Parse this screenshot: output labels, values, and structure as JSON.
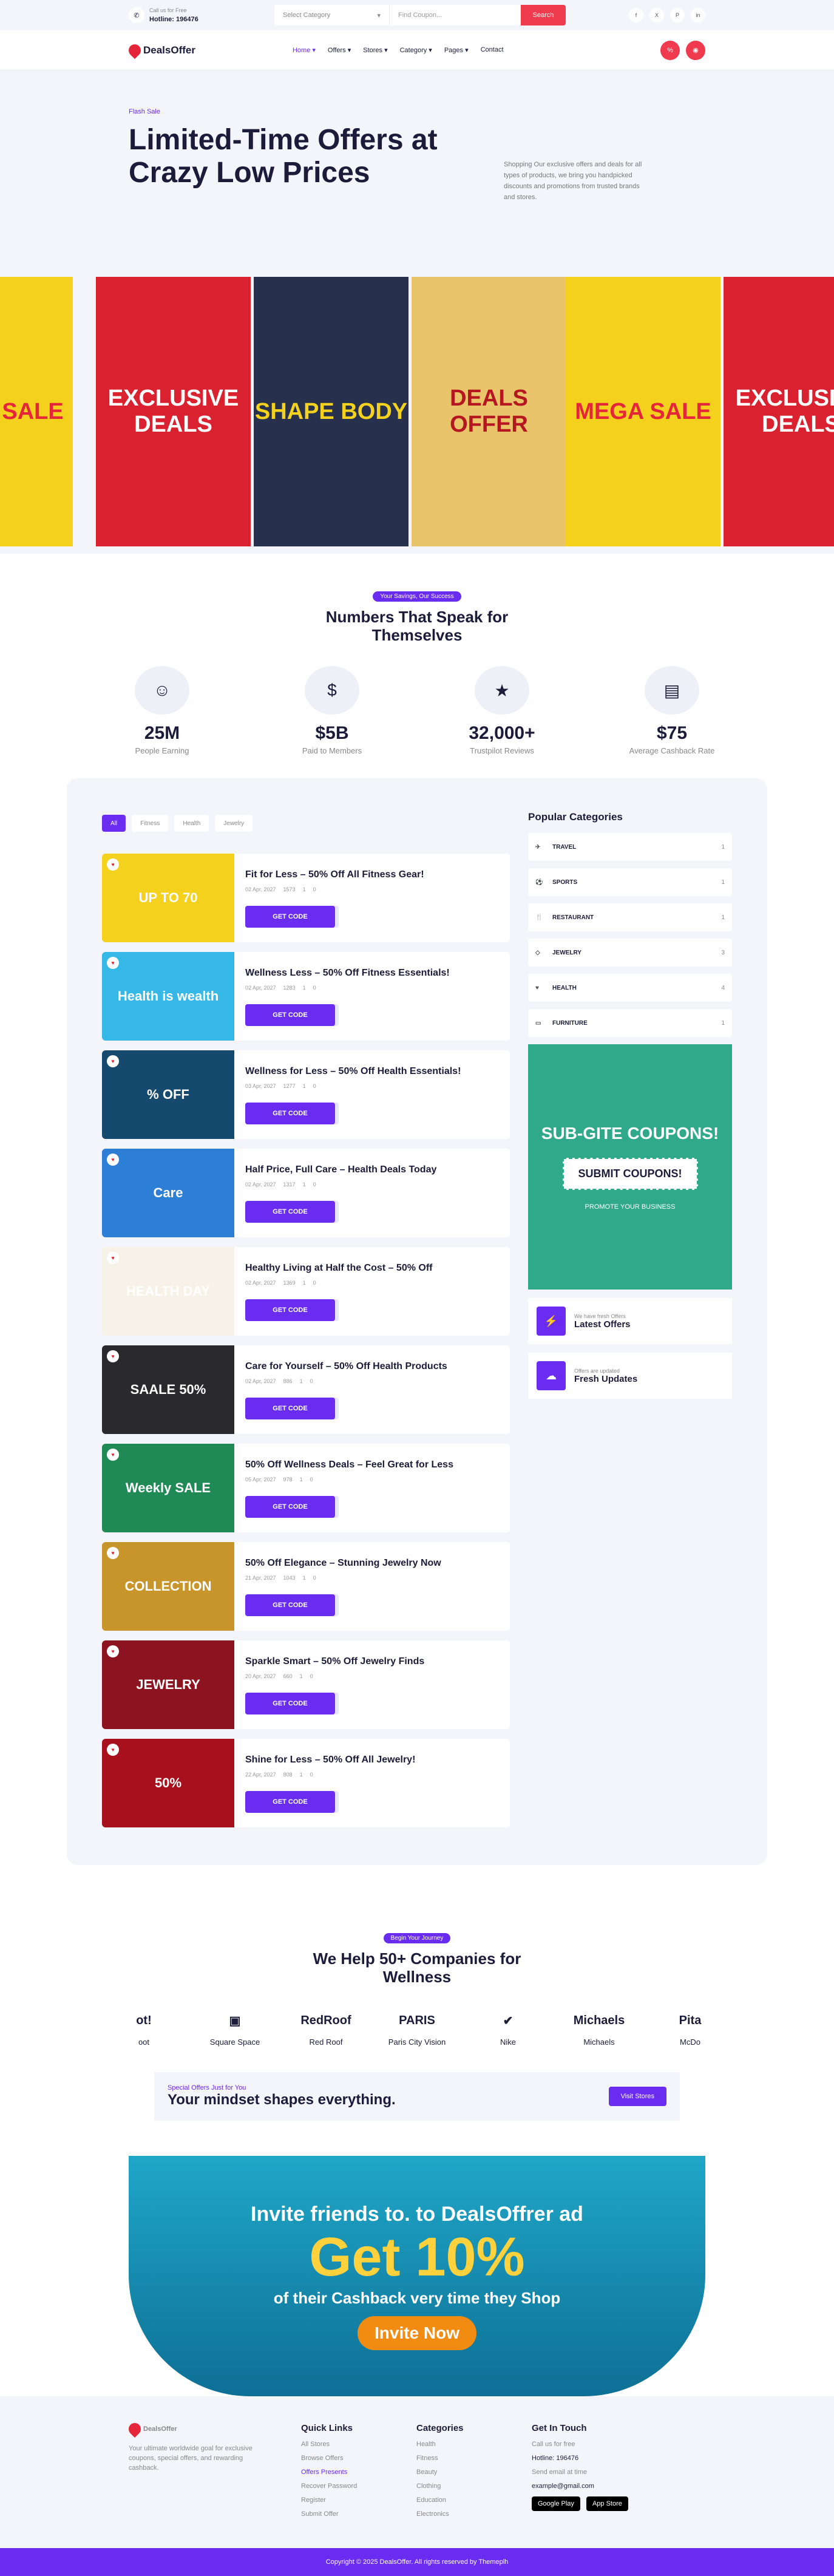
{
  "topbar": {
    "call_label": "Call us for Free",
    "hotline": "Hotline: 196476",
    "category_placeholder": "Select Category",
    "coupon_placeholder": "Find Coupon...",
    "search_label": "Search",
    "socials": [
      "f",
      "X",
      "P",
      "in"
    ]
  },
  "nav": {
    "brand": "DealsOffer",
    "menu": [
      "Home ▾",
      "Offers ▾",
      "Stores ▾",
      "Category ▾",
      "Pages ▾",
      "Contact"
    ]
  },
  "hero": {
    "kicker": "Flash Sale",
    "title": "Limited-Time Offers at Crazy Low Prices",
    "desc": "Shopping Our exclusive offers and deals for all types of products, we bring you handpicked discounts and promotions from trusted brands and stores."
  },
  "slides": [
    {
      "text": "MEGA SALE",
      "bg": "#f3d11c",
      "fg": "#e5263a"
    },
    {
      "text": "EXCLUSIVE DEALS",
      "bg": "#d9212f",
      "fg": "#ffffff"
    },
    {
      "text": "SHAPE BODY",
      "bg": "#27304d",
      "fg": "#f3d11c"
    },
    {
      "text": "DEALS OFFER",
      "bg": "#e9c46a",
      "fg": "#b5161f"
    },
    {
      "text": "MEGA SALE",
      "bg": "#f3d11c",
      "fg": "#e5263a"
    },
    {
      "text": "EXCLUSIVE DEALS",
      "bg": "#d9212f",
      "fg": "#ffffff"
    }
  ],
  "stats": {
    "pill": "Your Savings, Our Success",
    "title": "Numbers That Speak for Themselves",
    "items": [
      {
        "value": "25M",
        "label": "People Earning",
        "icon": "users-icon"
      },
      {
        "value": "$5B",
        "label": "Paid to Members",
        "icon": "money-icon"
      },
      {
        "value": "32,000+",
        "label": "Trustpilot Reviews",
        "icon": "review-icon"
      },
      {
        "value": "$75",
        "label": "Average Cashback Rate",
        "icon": "wallet-icon"
      }
    ]
  },
  "tabs": [
    "All",
    "Fitness",
    "Health",
    "Jewelry"
  ],
  "offers": [
    {
      "title": "Fit for Less – 50% Off All Fitness Gear!",
      "date": "02 Apr, 2027",
      "views": "1573",
      "likes": "1",
      "comments": "0",
      "img": "UP TO 70",
      "color": "#f3d11c"
    },
    {
      "title": "Wellness Less – 50% Off Fitness Essentials!",
      "date": "02 Apr, 2027",
      "views": "1283",
      "likes": "1",
      "comments": "0",
      "img": "Health is wealth",
      "color": "#35b8e6"
    },
    {
      "title": "Wellness for Less – 50% Off Health Essentials!",
      "date": "03 Apr, 2027",
      "views": "1277",
      "likes": "1",
      "comments": "0",
      "img": "% OFF",
      "color": "#16496e"
    },
    {
      "title": "Half Price, Full Care – Health Deals Today",
      "date": "02 Apr, 2027",
      "views": "1317",
      "likes": "1",
      "comments": "0",
      "img": "Care",
      "color": "#2d7fd6"
    },
    {
      "title": "Healthy Living at Half the Cost – 50% Off",
      "date": "02 Apr, 2027",
      "views": "1369",
      "likes": "1",
      "comments": "0",
      "img": "HEALTH DAY",
      "color": "#f7f2e8"
    },
    {
      "title": "Care for Yourself – 50% Off Health Products",
      "date": "02 Apr, 2027",
      "views": "886",
      "likes": "1",
      "comments": "0",
      "img": "SAALE 50%",
      "color": "#2a2a2e"
    },
    {
      "title": "50% Off Wellness Deals – Feel Great for Less",
      "date": "05 Apr, 2027",
      "views": "978",
      "likes": "1",
      "comments": "0",
      "img": "Weekly SALE",
      "color": "#1f8a55"
    },
    {
      "title": "50% Off Elegance – Stunning Jewelry Now",
      "date": "21 Apr, 2027",
      "views": "1043",
      "likes": "1",
      "comments": "0",
      "img": "COLLECTION",
      "color": "#c8952b"
    },
    {
      "title": "Sparkle Smart – 50% Off Jewelry Finds",
      "date": "20 Apr, 2027",
      "views": "660",
      "likes": "1",
      "comments": "0",
      "img": "JEWELRY",
      "color": "#8b1420"
    },
    {
      "title": "Shine for Less – 50% Off All Jewelry!",
      "date": "22 Apr, 2027",
      "views": "808",
      "likes": "1",
      "comments": "0",
      "img": "50%",
      "color": "#a8101d"
    }
  ],
  "get_code": "GET CODE",
  "sidebar": {
    "title": "Popular Categories",
    "cats": [
      {
        "name": "TRAVEL",
        "count": "1"
      },
      {
        "name": "SPORTS",
        "count": "1"
      },
      {
        "name": "RESTAURANT",
        "count": "1"
      },
      {
        "name": "JEWELRY",
        "count": "3"
      },
      {
        "name": "HEALTH",
        "count": "4"
      },
      {
        "name": "FURNITURE",
        "count": "1"
      }
    ],
    "promo_title": "SUB-GITE COUPONS!",
    "promo_btn": "SUBMIT COUPONS!",
    "promo_sub": "PROMOTE YOUR BUSINESS",
    "latest_small": "We have fresh Offers",
    "latest": "Latest Offers",
    "fresh_small": "Offers are updated",
    "fresh": "Fresh Updates"
  },
  "companies": {
    "pill": "Begin Your Journey",
    "title": "We Help 50+ Companies for Wellness",
    "logos": [
      {
        "mark": "ot!",
        "name": "oot"
      },
      {
        "mark": "▣",
        "name": "Square Space"
      },
      {
        "mark": "RedRoof",
        "name": "Red Roof"
      },
      {
        "mark": "PARIS",
        "name": "Paris City Vision"
      },
      {
        "mark": "✔",
        "name": "Nike"
      },
      {
        "mark": "Michaels",
        "name": "Michaels"
      },
      {
        "mark": "Pita",
        "name": "McDo"
      }
    ]
  },
  "cta": {
    "small": "Special Offers Just for You",
    "title": "Your mindset shapes everything.",
    "btn": "Visit Stores"
  },
  "banner": {
    "l1": "Invite friends to. to DealsOffrer ad",
    "l2": "Get 10%",
    "l3": "of their Cashback very time they Shop",
    "btn": "Invite Now"
  },
  "footer": {
    "brand": "DealsOffer",
    "desc": "Your ultimate worldwide goal for exclusive coupons, special offers, and rewarding cashback.",
    "q_title": "Quick Links",
    "quick": [
      "All Stores",
      "Browse Offers",
      "Offers Presents",
      "Recover Password",
      "Register",
      "Submit Offer"
    ],
    "c_title": "Categories",
    "cats": [
      "Health",
      "Fitness",
      "Beauty",
      "Clothing",
      "Education",
      "Electronics"
    ],
    "t_title": "Get In Touch",
    "call_small": "Call us for free",
    "hotline": "Hotline: 196476",
    "mail_small": "Send email at time",
    "email": "example@gmail.com",
    "gplay": "Google Play",
    "astore": "App Store",
    "copyright": "Copyright © 2025 DealsOffer. All rights reserved by Themeplh"
  }
}
